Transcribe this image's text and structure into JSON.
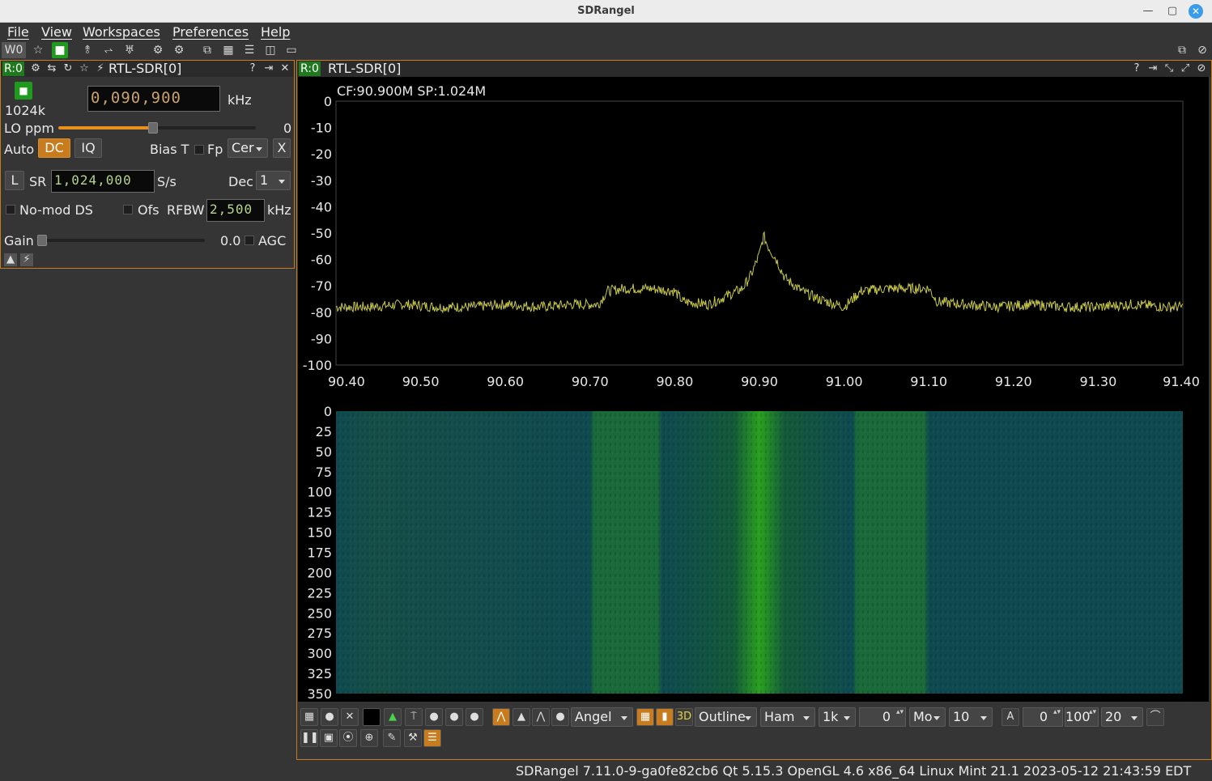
{
  "window": {
    "title": "SDRangel"
  },
  "menu": [
    "File",
    "View",
    "Workspaces",
    "Preferences",
    "Help"
  ],
  "toolbar": {
    "workspace": "W0"
  },
  "device": {
    "tag": "R:0",
    "name": "RTL-SDR[0]",
    "sample_rate_short": "1024k",
    "center_freq": "0,090,900",
    "freq_unit": "kHz",
    "lo_ppm_label": "LO ppm",
    "lo_ppm_value": "0",
    "lo_ppm_level": 0.48,
    "auto_label": "Auto",
    "dc_label": "DC",
    "iq_label": "IQ",
    "bias_t_label": "Bias T",
    "fp_label": "Fp",
    "cer_value": "Cer",
    "x_label": "X",
    "l_label": "L",
    "sr_label": "SR",
    "sr_value": "1,024,000",
    "sr_unit": "S/s",
    "dec_label": "Dec",
    "dec_value": "1",
    "nomod_label": "No-mod DS",
    "ofs_label": "Ofs",
    "rfbw_label": "RFBW",
    "rfbw_value": "2,500",
    "rfbw_unit": "kHz",
    "gain_label": "Gain",
    "gain_value": "0.0",
    "gain_level": 0,
    "agc_label": "AGC"
  },
  "spectrum_panel": {
    "tag": "R:0",
    "name": "RTL-SDR[0]",
    "info": "CF:90.900M SP:1.024M"
  },
  "chart_data": {
    "type": "line",
    "y_ticks": [
      "0",
      "-10",
      "-20",
      "-30",
      "-40",
      "-50",
      "-60",
      "-70",
      "-80",
      "-90",
      "-100"
    ],
    "x_ticks": [
      "90.40",
      "90.50",
      "90.60",
      "90.70",
      "90.80",
      "90.90",
      "91.00",
      "91.10",
      "91.20",
      "91.30",
      "91.40"
    ],
    "xlim": [
      90.4,
      91.4
    ],
    "ylim": [
      -100,
      0
    ],
    "series_color": "#c8c84a",
    "points": [
      [
        90.4,
        -78
      ],
      [
        90.44,
        -78
      ],
      [
        90.48,
        -77
      ],
      [
        90.52,
        -78
      ],
      [
        90.56,
        -78
      ],
      [
        90.6,
        -77
      ],
      [
        90.64,
        -78
      ],
      [
        90.68,
        -77
      ],
      [
        90.71,
        -77
      ],
      [
        90.72,
        -72
      ],
      [
        90.74,
        -71
      ],
      [
        90.77,
        -71
      ],
      [
        90.8,
        -72
      ],
      [
        90.81,
        -76
      ],
      [
        90.84,
        -77
      ],
      [
        90.86,
        -74
      ],
      [
        90.88,
        -71
      ],
      [
        90.89,
        -66
      ],
      [
        90.9,
        -58
      ],
      [
        90.905,
        -51
      ],
      [
        90.91,
        -55
      ],
      [
        90.92,
        -60
      ],
      [
        90.93,
        -67
      ],
      [
        90.95,
        -72
      ],
      [
        90.97,
        -75
      ],
      [
        90.99,
        -77
      ],
      [
        91.0,
        -78
      ],
      [
        91.02,
        -72
      ],
      [
        91.05,
        -71
      ],
      [
        91.08,
        -71
      ],
      [
        91.1,
        -71
      ],
      [
        91.11,
        -76
      ],
      [
        91.14,
        -77
      ],
      [
        91.18,
        -78
      ],
      [
        91.22,
        -77
      ],
      [
        91.26,
        -78
      ],
      [
        91.3,
        -78
      ],
      [
        91.34,
        -77
      ],
      [
        91.38,
        -78
      ],
      [
        91.4,
        -78
      ]
    ],
    "waterfall_ticks": [
      "0",
      "25",
      "50",
      "75",
      "100",
      "125",
      "150",
      "175",
      "200",
      "225",
      "250",
      "275",
      "300",
      "325",
      "350"
    ]
  },
  "bottom_toolbar": {
    "palette": "Angel",
    "style": "Outline",
    "window": "Ham",
    "fft_size": "1k",
    "avg_value": "0",
    "avg_mode": "Mo",
    "rate": "10",
    "a_label": "A",
    "ref_value": "0",
    "range_value": "100",
    "fps": "20"
  },
  "status": {
    "text": "SDRangel 7.11.0-9-ga0fe82cb6 Qt 5.15.3 OpenGL 4.6 x86_64 Linux Mint 21.1 2023-05-12 21:43:59 EDT"
  }
}
